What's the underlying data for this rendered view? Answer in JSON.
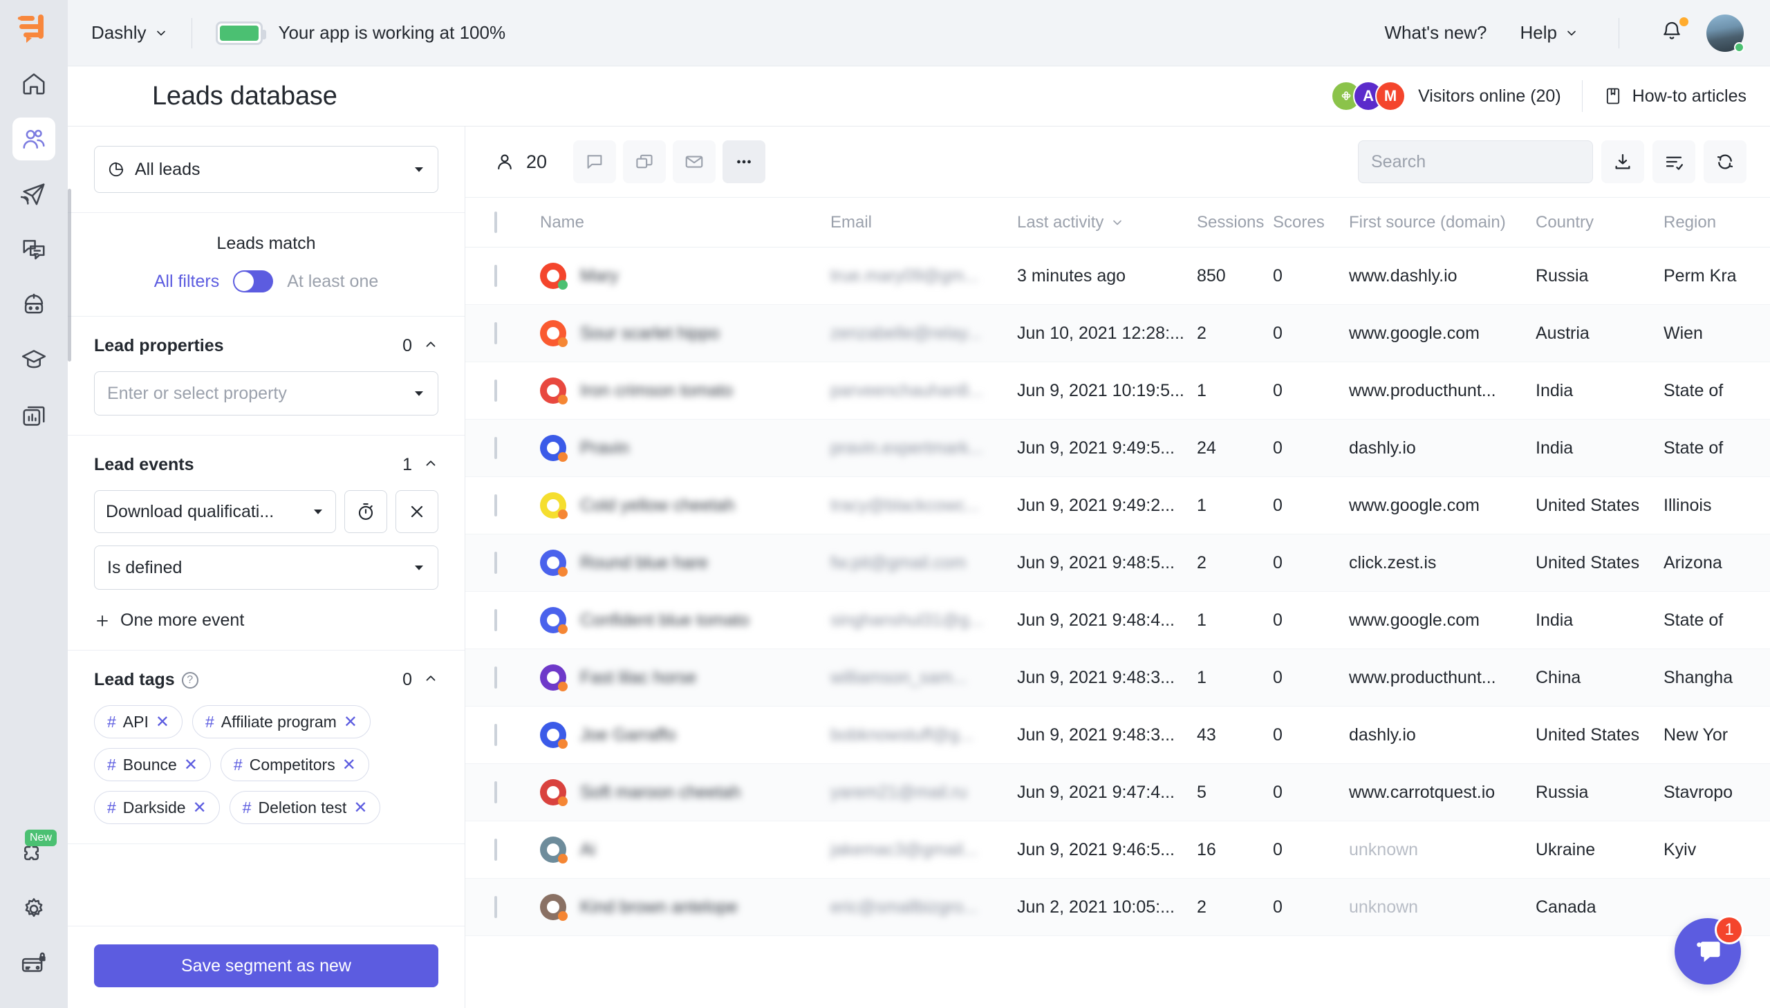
{
  "rail": {
    "logo_icon": "dashly-logo-icon",
    "items": [
      {
        "name": "home",
        "icon": "home-icon",
        "active": false
      },
      {
        "name": "leads",
        "icon": "users-icon",
        "active": true
      },
      {
        "name": "campaigns",
        "icon": "paper-plane-icon",
        "active": false
      },
      {
        "name": "conversations",
        "icon": "chat-bubbles-icon",
        "active": false
      },
      {
        "name": "bots",
        "icon": "robot-icon",
        "active": false
      },
      {
        "name": "knowledge",
        "icon": "graduation-cap-icon",
        "active": false
      },
      {
        "name": "analytics",
        "icon": "chart-docs-icon",
        "active": false
      }
    ],
    "bottom": [
      {
        "name": "integrations",
        "icon": "puzzle-icon",
        "badge": "New"
      },
      {
        "name": "settings",
        "icon": "gear-icon",
        "badge": ""
      },
      {
        "name": "billing",
        "icon": "card-lock-icon",
        "badge": ""
      }
    ]
  },
  "topbar": {
    "project": "Dashly",
    "status_text": "Your app is working at 100%",
    "status_color": "#4BC072",
    "whats_new": "What's new?",
    "help": "Help",
    "bell_icon": "bell-icon",
    "avatar_icon": "user-avatar"
  },
  "page": {
    "title": "Leads database",
    "visitors_label": "Visitors online (20)",
    "visitor_avatars": [
      {
        "letter": "",
        "color": "#8BC34A",
        "icon": "grape-icon"
      },
      {
        "letter": "A",
        "color": "#5B2BCB"
      },
      {
        "letter": "M",
        "color": "#F4452C"
      }
    ],
    "howto_label": "How-to articles",
    "howto_icon": "book-icon"
  },
  "panel": {
    "segment_select": {
      "value": "All leads",
      "icon": "pie-chart-icon"
    },
    "leads_match": {
      "title": "Leads match",
      "option_all": "All filters",
      "option_any": "At least one",
      "toggle_on": true
    },
    "lead_properties": {
      "title": "Lead properties",
      "count": "0",
      "property_placeholder": "Enter or select property"
    },
    "lead_events": {
      "title": "Lead events",
      "count": "1",
      "event_value": "Download qualificati...",
      "timer_icon": "stopwatch-icon",
      "remove_icon": "close-icon",
      "condition_value": "Is defined",
      "add_more": "One more event"
    },
    "lead_tags": {
      "title": "Lead tags",
      "help_icon": "question-icon",
      "count": "0",
      "tags": [
        "API",
        "Affiliate program",
        "Bounce",
        "Competitors",
        "Darkside",
        "Deletion test"
      ]
    },
    "save_button": "Save segment as new"
  },
  "toolbar": {
    "count": "20",
    "count_icon": "person-icon",
    "actions": [
      {
        "name": "note",
        "icon": "speech-bubble-icon"
      },
      {
        "name": "copy",
        "icon": "copy-icon"
      },
      {
        "name": "email",
        "icon": "envelope-icon"
      },
      {
        "name": "more",
        "icon": "ellipsis-icon"
      }
    ],
    "search_placeholder": "Search",
    "search_value": "",
    "search_icon": "search-icon",
    "right_actions": [
      {
        "name": "export",
        "icon": "download-icon"
      },
      {
        "name": "columns",
        "icon": "list-settings-icon"
      },
      {
        "name": "refresh",
        "icon": "refresh-icon"
      }
    ]
  },
  "table": {
    "columns": [
      "Name",
      "Email",
      "Last activity",
      "Sessions",
      "Scores",
      "First source (domain)",
      "Country",
      "Region"
    ],
    "sorted_column": "Last activity",
    "sort_icon": "chevron-down-icon",
    "rows": [
      {
        "name": "Mary",
        "name_blurred": true,
        "email": "true.mary09@gm...",
        "last_activity": "3 minutes ago",
        "sessions": "850",
        "scores": "0",
        "first_source": "www.dashly.io",
        "country": "Russia",
        "region": "Perm Kra",
        "avatar_color": "#F4452C",
        "online": true
      },
      {
        "name": "Sour scarlet hippo",
        "name_blurred": true,
        "email": "zenzabelle@relay...",
        "last_activity": "Jun 10, 2021 12:28:...",
        "sessions": "2",
        "scores": "0",
        "first_source": "www.google.com",
        "country": "Austria",
        "region": "Wien",
        "avatar_color": "#FA5A30",
        "online": false
      },
      {
        "name": "Iron crimson tomato",
        "name_blurred": true,
        "email": "parveenchauhan8...",
        "last_activity": "Jun 9, 2021 10:19:5...",
        "sessions": "1",
        "scores": "0",
        "first_source": "www.producthunt...",
        "country": "India",
        "region": "State of",
        "avatar_color": "#E8483F",
        "online": false
      },
      {
        "name": "Pravin",
        "name_blurred": true,
        "email": "pravin.expertmark...",
        "last_activity": "Jun 9, 2021 9:49:5...",
        "sessions": "24",
        "scores": "0",
        "first_source": "dashly.io",
        "country": "India",
        "region": "State of",
        "avatar_color": "#3B5BE8",
        "online": false
      },
      {
        "name": "Cold yellow cheetah",
        "name_blurred": true,
        "email": "tracy@blackcowc...",
        "last_activity": "Jun 9, 2021 9:49:2...",
        "sessions": "1",
        "scores": "0",
        "first_source": "www.google.com",
        "country": "United States",
        "region": "Illinois",
        "avatar_color": "#F5DE2E",
        "online": false
      },
      {
        "name": "Round blue hare",
        "name_blurred": true,
        "email": "fw.pit@gmail.com",
        "last_activity": "Jun 9, 2021 9:48:5...",
        "sessions": "2",
        "scores": "0",
        "first_source": "click.zest.is",
        "country": "United States",
        "region": "Arizona",
        "avatar_color": "#4A62EC",
        "online": false
      },
      {
        "name": "Confident blue tomato",
        "name_blurred": true,
        "email": "singhanshul31@g...",
        "last_activity": "Jun 9, 2021 9:48:4...",
        "sessions": "1",
        "scores": "0",
        "first_source": "www.google.com",
        "country": "India",
        "region": "State of",
        "avatar_color": "#4A62EC",
        "online": false
      },
      {
        "name": "Fast lilac horse",
        "name_blurred": true,
        "email": "williamson_sam...",
        "last_activity": "Jun 9, 2021 9:48:3...",
        "sessions": "1",
        "scores": "0",
        "first_source": "www.producthunt...",
        "country": "China",
        "region": "Shangha",
        "avatar_color": "#6E39C9",
        "online": false
      },
      {
        "name": "Joe Garraffo",
        "name_blurred": true,
        "email": "bobknowstuff@g...",
        "last_activity": "Jun 9, 2021 9:48:3...",
        "sessions": "43",
        "scores": "0",
        "first_source": "dashly.io",
        "country": "United States",
        "region": "New Yor",
        "avatar_color": "#3B5BE8",
        "online": false
      },
      {
        "name": "Soft maroon cheetah",
        "name_blurred": true,
        "email": "yarem21@mail.ru",
        "last_activity": "Jun 9, 2021 9:47:4...",
        "sessions": "5",
        "scores": "0",
        "first_source": "www.carrotquest.io",
        "country": "Russia",
        "region": "Stavropo",
        "avatar_color": "#D9423E",
        "online": false
      },
      {
        "name": "Ai",
        "name_blurred": true,
        "email": "jakemac3@gmail...",
        "last_activity": "Jun 9, 2021 9:46:5...",
        "sessions": "16",
        "scores": "0",
        "first_source": "unknown",
        "country": "Ukraine",
        "region": "Kyiv",
        "avatar_color": "#6E8C9B",
        "online": false
      },
      {
        "name": "Kind brown antelope",
        "name_blurred": true,
        "email": "eric@smallbizgro...",
        "last_activity": "Jun 2, 2021 10:05:...",
        "sessions": "2",
        "scores": "0",
        "first_source": "unknown",
        "country": "Canada",
        "region": "",
        "avatar_color": "#8A7164",
        "online": false
      }
    ]
  },
  "chat_widget": {
    "icon": "chat-icon",
    "badge": "1",
    "color": "#5C5CE0"
  }
}
